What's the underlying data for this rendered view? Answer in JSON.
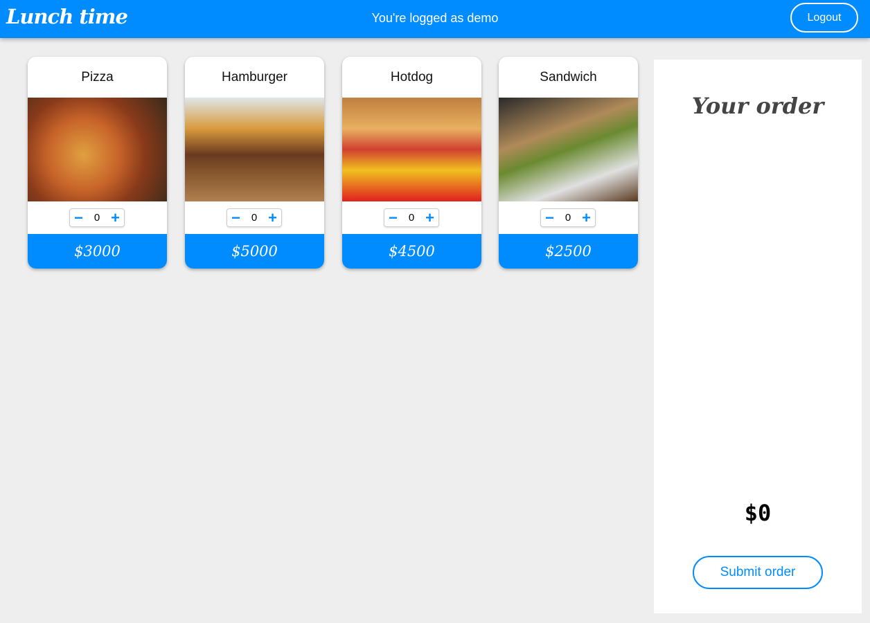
{
  "header": {
    "logo": "Lunch time",
    "status": "You're logged as demo",
    "logout": "Logout"
  },
  "products": [
    {
      "name": "Pizza",
      "qty": "0",
      "price": "$3000",
      "image": "pizza-image"
    },
    {
      "name": "Hamburger",
      "qty": "0",
      "price": "$5000",
      "image": "hamburger-image"
    },
    {
      "name": "Hotdog",
      "qty": "0",
      "price": "$4500",
      "image": "hotdog-image"
    },
    {
      "name": "Sandwich",
      "qty": "0",
      "price": "$2500",
      "image": "sandwich-image"
    }
  ],
  "stepper": {
    "minus": "−",
    "plus": "+"
  },
  "order": {
    "title": "Your order",
    "total": "$0",
    "submit": "Submit order"
  }
}
